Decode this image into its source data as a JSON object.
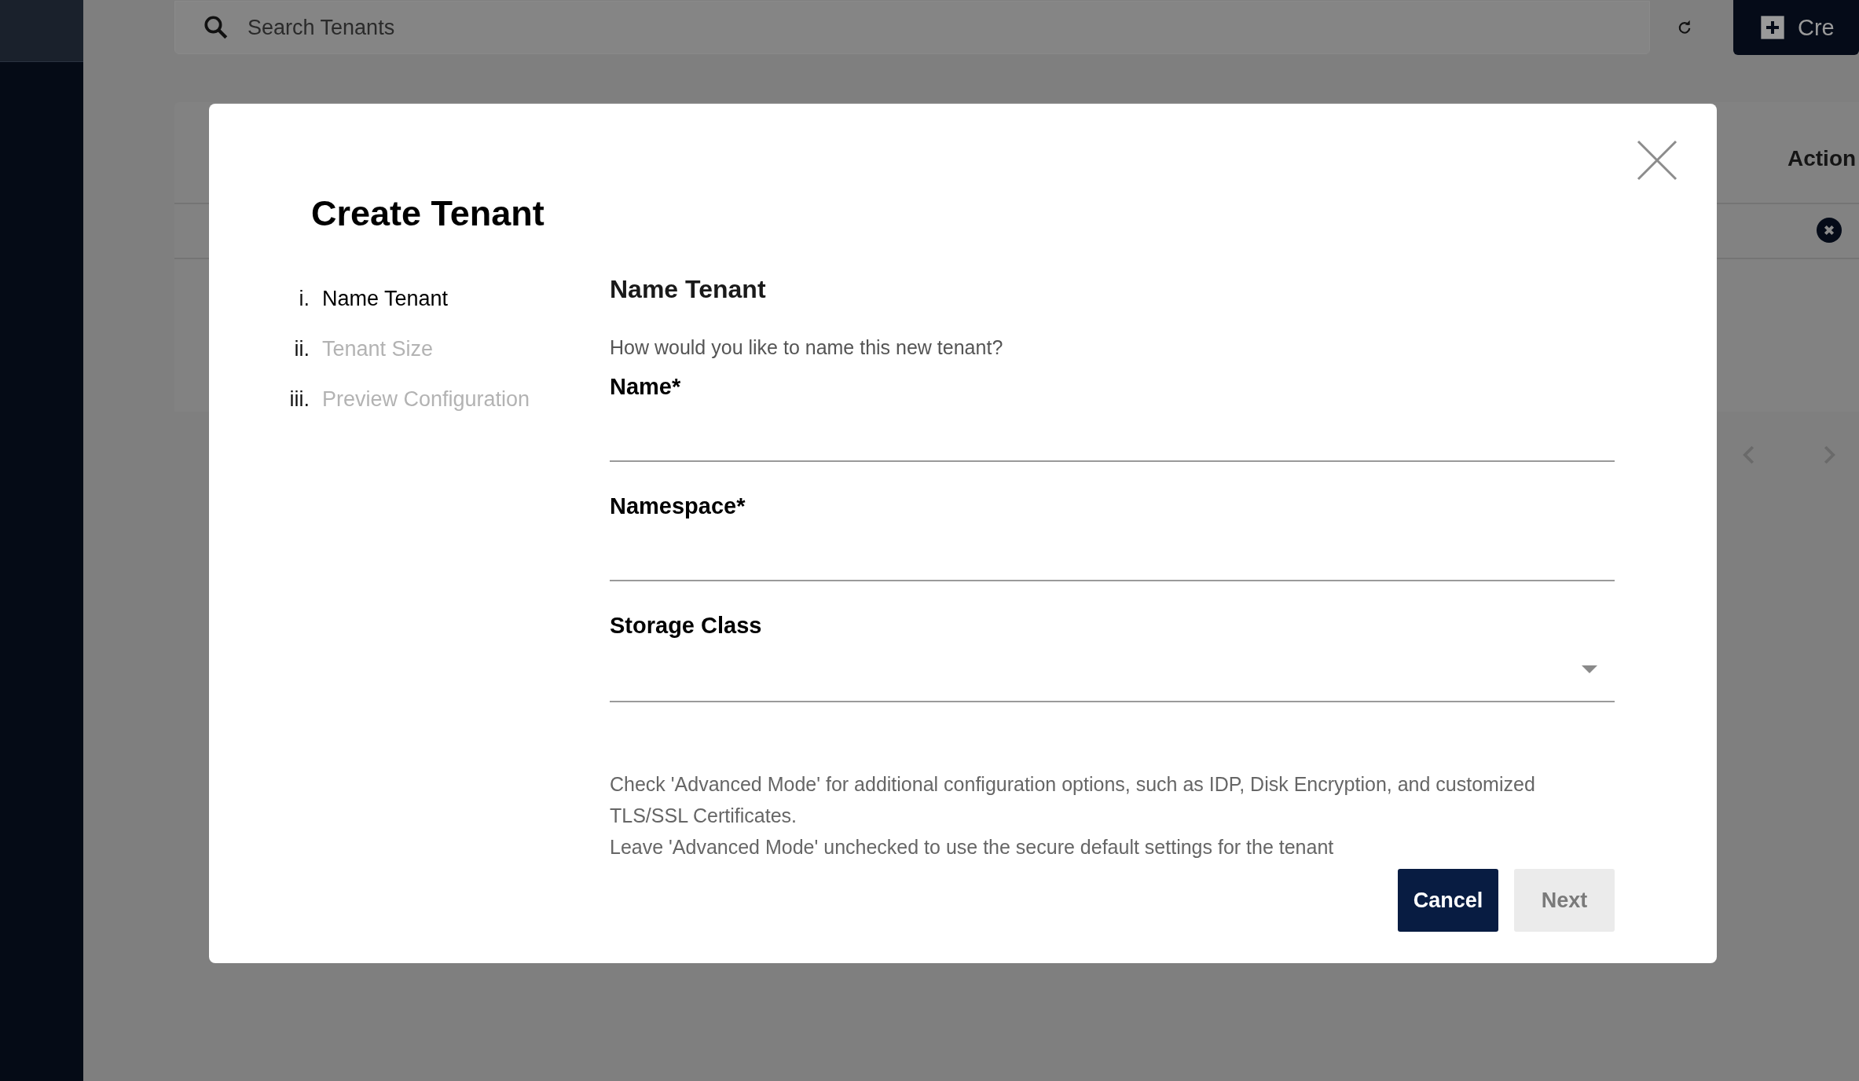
{
  "search": {
    "placeholder": "Search Tenants"
  },
  "create_button": {
    "label": "Cre"
  },
  "table": {
    "columns": [
      "Action"
    ]
  },
  "dialog": {
    "title": "Create Tenant",
    "steps": [
      {
        "number": "i.",
        "label": "Name Tenant",
        "selected": true
      },
      {
        "number": "ii.",
        "label": "Tenant Size",
        "selected": false
      },
      {
        "number": "iii.",
        "label": "Preview Configuration",
        "selected": false
      }
    ],
    "section_title": "Name Tenant",
    "description": "How would you like to name this new tenant?",
    "fields": [
      {
        "kind": "text",
        "label": "Name*"
      },
      {
        "kind": "text",
        "label": "Namespace*"
      },
      {
        "kind": "select",
        "label": "Storage Class"
      }
    ],
    "notes": [
      "Check 'Advanced Mode' for additional configuration options, such as IDP, Disk Encryption, and customized TLS/SSL Certificates.",
      "Leave 'Advanced Mode' unchecked to use the secure default settings for the tenant"
    ],
    "buttons": [
      {
        "label": "Cancel",
        "disabled": false
      },
      {
        "label": "Next",
        "disabled": true
      }
    ]
  }
}
